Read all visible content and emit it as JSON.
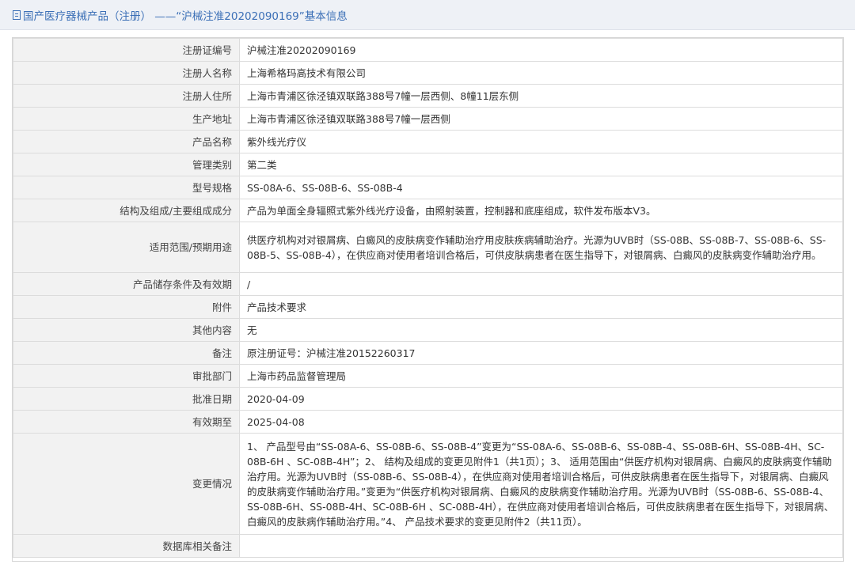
{
  "header": {
    "title": "国产医疗器械产品（注册） ——“沪械注准20202090169”基本信息"
  },
  "rows": [
    {
      "label": "注册证编号",
      "value": "沪械注准20202090169"
    },
    {
      "label": "注册人名称",
      "value": "上海希格玛高技术有限公司"
    },
    {
      "label": "注册人住所",
      "value": "上海市青浦区徐泾镇双联路388号7幢一层西侧、8幢11层东侧"
    },
    {
      "label": "生产地址",
      "value": "上海市青浦区徐泾镇双联路388号7幢一层西侧"
    },
    {
      "label": "产品名称",
      "value": "紫外线光疗仪"
    },
    {
      "label": "管理类别",
      "value": "第二类"
    },
    {
      "label": "型号规格",
      "value": "SS-08A-6、SS-08B-6、SS-08B-4"
    },
    {
      "label": "结构及组成/主要组成成分",
      "value": "产品为单面全身辐照式紫外线光疗设备，由照射装置，控制器和底座组成，软件发布版本V3。"
    },
    {
      "label": "适用范围/预期用途",
      "value": "供医疗机构对对银屑病、白癜风的皮肤病变作辅助治疗用皮肤疾病辅助治疗。光源为UVB时（SS-08B、SS-08B-7、SS-08B-6、SS-08B-5、SS-08B-4），在供应商对使用者培训合格后，可供皮肤病患者在医生指导下，对银屑病、白癜风的皮肤病变作辅助治疗用。"
    },
    {
      "label": "产品储存条件及有效期",
      "value": "/"
    },
    {
      "label": "附件",
      "value": "产品技术要求"
    },
    {
      "label": "其他内容",
      "value": "无"
    },
    {
      "label": "备注",
      "value": "原注册证号：沪械注准20152260317"
    },
    {
      "label": "审批部门",
      "value": "上海市药品监督管理局"
    },
    {
      "label": "批准日期",
      "value": "2020-04-09"
    },
    {
      "label": "有效期至",
      "value": "2025-04-08"
    },
    {
      "label": "变更情况",
      "value": "1、 产品型号由“SS-08A-6、SS-08B-6、SS-08B-4”变更为“SS-08A-6、SS-08B-6、SS-08B-4、SS-08B-6H、SS-08B-4H、SC-08B-6H 、SC-08B-4H”；2、 结构及组成的变更见附件1（共1页）；3、 适用范围由“供医疗机构对银屑病、白癜风的皮肤病变作辅助治疗用。光源为UVB时（SS-08B-6、SS-08B-4），在供应商对使用者培训合格后，可供皮肤病患者在医生指导下，对银屑病、白癜风的皮肤病变作辅助治疗用。”变更为“供医疗机构对银屑病、白癜风的皮肤病变作辅助治疗用。光源为UVB时（SS-08B-6、SS-08B-4、SS-08B-6H、SS-08B-4H、SC-08B-6H 、SC-08B-4H），在供应商对使用者培训合格后，可供皮肤病患者在医生指导下，对银屑病、白癜风的皮肤病作辅助治疗用。”4、 产品技术要求的变更见附件2（共11页）。"
    },
    {
      "label": "数据库相关备注",
      "value": ""
    }
  ]
}
